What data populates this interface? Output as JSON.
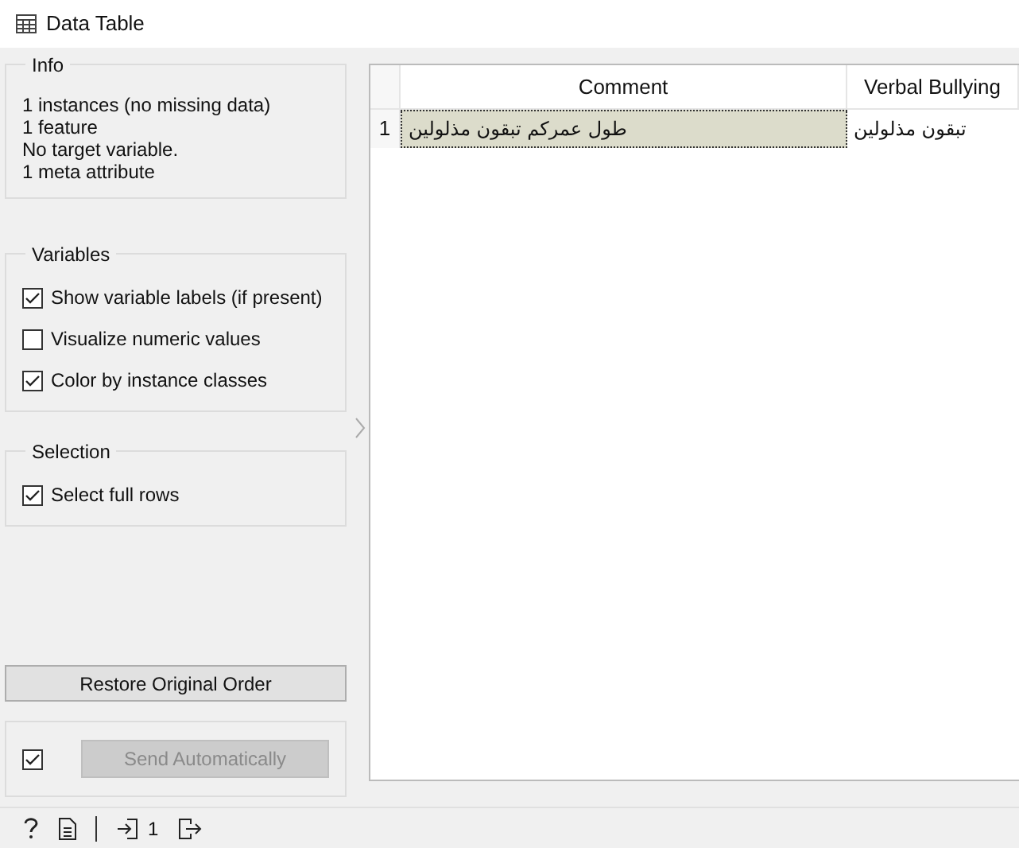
{
  "window": {
    "title": "Data Table"
  },
  "info": {
    "title": "Info",
    "lines": [
      "1 instances (no missing data)",
      "1 feature",
      "No target variable.",
      "1 meta attribute"
    ]
  },
  "variables": {
    "title": "Variables",
    "options": [
      {
        "label": "Show variable labels (if present)",
        "checked": true
      },
      {
        "label": "Visualize numeric values",
        "checked": false
      },
      {
        "label": "Color by instance classes",
        "checked": true
      }
    ]
  },
  "selection": {
    "title": "Selection",
    "options": [
      {
        "label": "Select full rows",
        "checked": true
      }
    ]
  },
  "restore_button": {
    "label": "Restore Original Order"
  },
  "auto_send": {
    "checked": true,
    "label": "Send Automatically",
    "disabled": true
  },
  "table": {
    "columns": [
      "Comment",
      "Verbal Bullying"
    ],
    "rows": [
      {
        "header": "1",
        "cells": [
          "طول عمركم تبقون مذلولين",
          "تبقون مذلولين"
        ],
        "selected": true
      }
    ]
  },
  "status_bar": {
    "input_count": "1"
  }
}
